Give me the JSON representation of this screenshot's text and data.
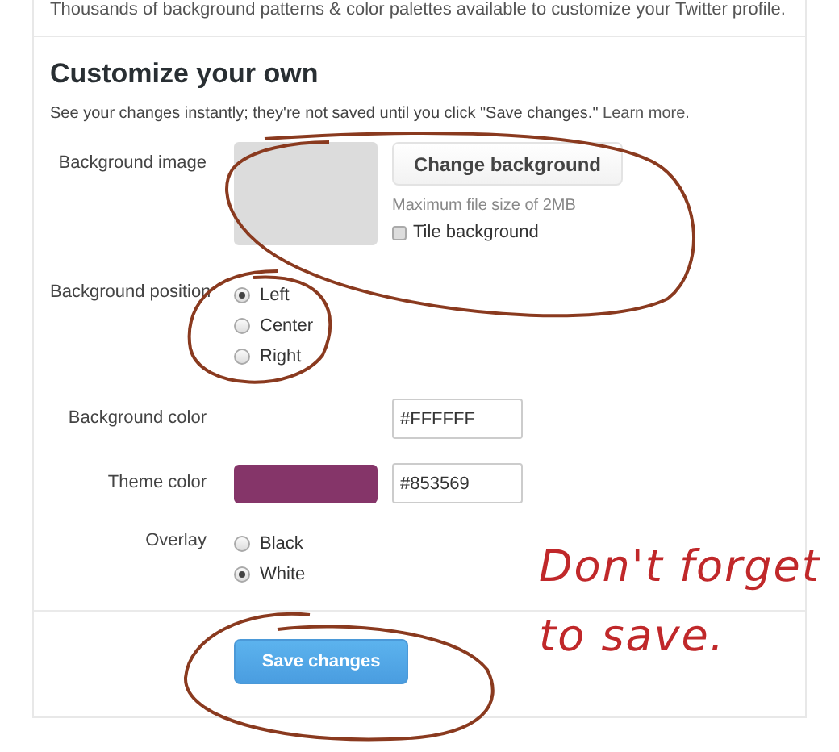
{
  "intro": "Thousands of background patterns & color palettes available to customize your Twitter profile.",
  "heading": "Customize your own",
  "description": "See your changes instantly; they're not saved until you click \"Save changes.\"",
  "learn_more": "Learn more.",
  "background_image": {
    "label": "Background image",
    "button": "Change background",
    "hint": "Maximum file size of 2MB",
    "tile": {
      "label": "Tile background",
      "checked": false
    }
  },
  "background_position": {
    "label": "Background position",
    "options": [
      {
        "label": "Left",
        "selected": true
      },
      {
        "label": "Center",
        "selected": false
      },
      {
        "label": "Right",
        "selected": false
      }
    ]
  },
  "background_color": {
    "label": "Background color",
    "value": "#FFFFFF"
  },
  "theme_color": {
    "label": "Theme color",
    "value": "#853569"
  },
  "overlay": {
    "label": "Overlay",
    "options": [
      {
        "label": "Black",
        "selected": false
      },
      {
        "label": "White",
        "selected": true
      }
    ]
  },
  "save_button": "Save changes",
  "annotation": "Don't forget to save."
}
